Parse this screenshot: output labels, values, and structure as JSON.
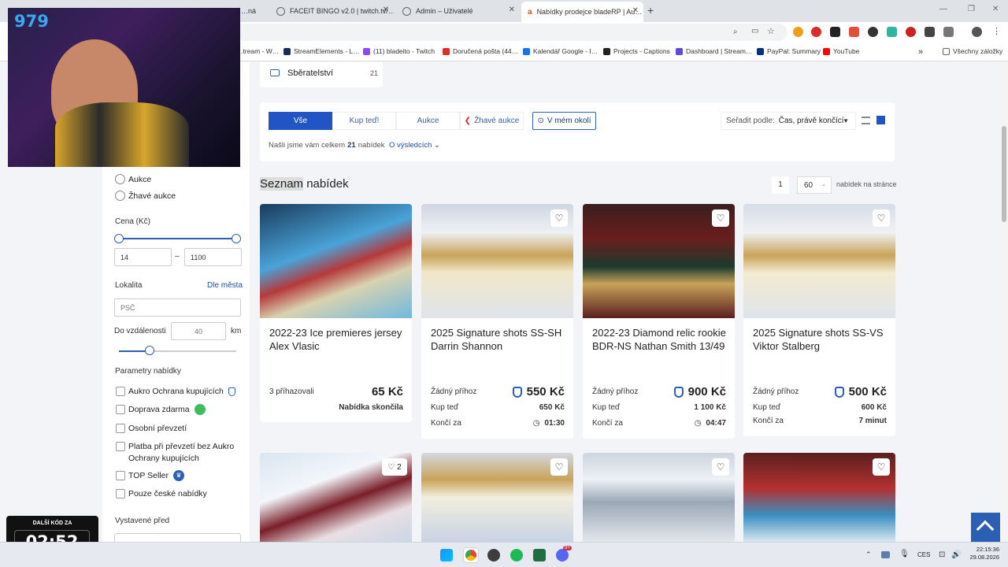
{
  "browser": {
    "tabs": [
      {
        "label": "…ná"
      },
      {
        "label": "FACEIT BINGO v2.0 | twitch.tv/…"
      },
      {
        "label": "Admin – Uživatelé"
      },
      {
        "label": "Nabídky prodejce bladeRP | Au…"
      }
    ],
    "bookmarks": [
      {
        "label": "…tream - W…",
        "color": "#888888"
      },
      {
        "label": "StreamElements - L…",
        "color": "#1d2b5a"
      },
      {
        "label": "(11) bladeito - Twitch",
        "color": "#9146ff"
      },
      {
        "label": "Doručená pošta (44…",
        "color": "#d93025"
      },
      {
        "label": "Kalendář Google - I…",
        "color": "#1a73e8"
      },
      {
        "label": "Projects - Captions",
        "color": "#222222"
      },
      {
        "label": "Dashboard | Stream…",
        "color": "#5b4bd6"
      },
      {
        "label": "PayPal: Summary",
        "color": "#003087"
      },
      {
        "label": "YouTube",
        "color": "#ff0000"
      }
    ],
    "bookmarks_more": "»",
    "all_bookmarks": "Všechny záložky"
  },
  "sidebar": {
    "radio_auction": "Aukce",
    "radio_hot": "Žhavé aukce",
    "price_label": "Cena (Kč)",
    "price_min": "14",
    "price_max": "1100",
    "price_dash": "–",
    "location_label": "Lokalita",
    "by_city": "Dle města",
    "zip_placeholder": "PSČ",
    "distance_label": "Do vzdálenosti",
    "distance_placeholder": "40",
    "distance_unit": "km",
    "distance_level": 0.26,
    "params_label": "Parametry nabídky",
    "params": [
      "Aukro Ochrana kupujících",
      "Doprava zdarma",
      "Osobní převzetí",
      "Platba při převzetí bez Aukro Ochrany kupujících",
      "TOP Seller",
      "Pouze české nabídky"
    ],
    "listed_label": "Vystavené před"
  },
  "category": {
    "label": "Sběratelství",
    "count": "21"
  },
  "filters": {
    "tabs": [
      "Vše",
      "Kup teď!",
      "Aukce",
      "Žhavé aukce"
    ],
    "near_me": "V mém okolí",
    "sort_label": "Seřadit podle:",
    "sort_value": "Čas, právě končící",
    "found_prefix": "Našli jsme vám celkem",
    "found_count": "21",
    "found_suffix": "nabídek",
    "about_results": "O výsledcích"
  },
  "list": {
    "title_hl": "Seznam",
    "title_rest": " nabídek",
    "page": "1",
    "per_page": "60",
    "per_page_label": "nabídek na stránce"
  },
  "cards": [
    {
      "title": "2022-23 Ice premieres jersey Alex Vlasic",
      "bids": "3 příhazovali",
      "price": "65 Kč",
      "status": "Nabídka skončila"
    },
    {
      "title": "2025 Signature shots SS-SH Darrin Shannon",
      "bids": "Žádný příhoz",
      "price": "550 Kč",
      "buy_label": "Kup teď",
      "buy_price": "650 Kč",
      "ends_label": "Končí za",
      "ends": "01:30"
    },
    {
      "title": "2022-23 Diamond relic rookie BDR-NS Nathan Smith 13/49",
      "bids": "Žádný příhoz",
      "price": "900 Kč",
      "buy_label": "Kup teď",
      "buy_price": "1 100 Kč",
      "ends_label": "Končí za",
      "ends": "04:47"
    },
    {
      "title": "2025 Signature shots SS-VS Viktor Stalberg",
      "bids": "Žádný příhoz",
      "price": "500 Kč",
      "buy_label": "Kup teď",
      "buy_price": "600 Kč",
      "ends_label": "Končí za",
      "ends": "7 minut"
    }
  ],
  "second_row_likes": "2",
  "overlay": {
    "counter": "979",
    "next_code_label": "DALŠÍ KÓD ZA",
    "timer": "02:52"
  },
  "taskbar": {
    "lang": "CES",
    "time": "22:15:36",
    "date": "29.08.2026",
    "badge": "9+"
  },
  "colors": {
    "accent": "#2d5fb5",
    "tab_active": "#2255c4",
    "link": "#1a4fa8"
  }
}
